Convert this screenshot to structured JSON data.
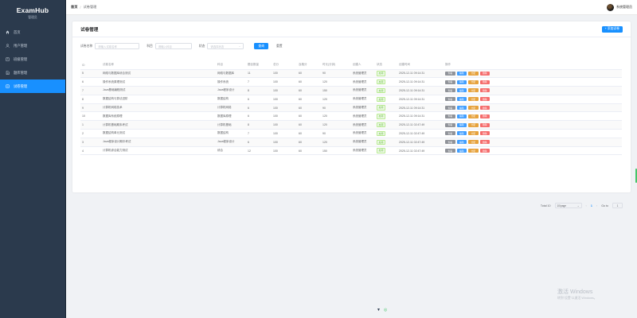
{
  "app": {
    "title": "ExamHub",
    "subtitle": "管理员"
  },
  "sidebar": {
    "items": [
      {
        "label": "首页",
        "icon": "home-icon",
        "active": false
      },
      {
        "label": "用户管理",
        "icon": "user-icon",
        "active": false
      },
      {
        "label": "班级管理",
        "icon": "building-icon",
        "active": false
      },
      {
        "label": "题库管理",
        "icon": "document-icon",
        "active": false
      },
      {
        "label": "试卷管理",
        "icon": "paper-icon",
        "active": true
      }
    ]
  },
  "breadcrumb": {
    "home": "首页",
    "separator": "/",
    "current": "试卷管理"
  },
  "user": {
    "name": "系统管理员"
  },
  "card": {
    "title": "试卷管理",
    "add_label": "+ 添加试卷"
  },
  "filters": {
    "name_label": "试卷名称",
    "name_placeholder": "请输入试卷名称",
    "subject_label": "科目",
    "subject_placeholder": "请输入科目",
    "status_label": "状态",
    "status_placeholder": "请选择状态",
    "query_label": "查询",
    "reset_label": "重置"
  },
  "table": {
    "headers": [
      "ID",
      "试卷名称",
      "科目",
      "题目数量",
      "总分",
      "及格分",
      "时长(分钟)",
      "创建人",
      "状态",
      "创建时间",
      "操作"
    ],
    "op_labels": {
      "view": "查看",
      "edit": "编辑",
      "assign": "分配",
      "delete": "删除"
    },
    "rows": [
      {
        "id": "5",
        "name": "网络与数据库综合测试",
        "subject": "网络与数据库",
        "count": "11",
        "total": "100",
        "pass": "60",
        "duration": "90",
        "creator": "系统管理员",
        "status": "启用",
        "created": "2025-12-11 09:14:31"
      },
      {
        "id": "6",
        "name": "操作系统原理测试",
        "subject": "操作系统",
        "count": "7",
        "total": "100",
        "pass": "60",
        "duration": "120",
        "creator": "系统管理员",
        "status": "启用",
        "created": "2025-12-11 09:14:31"
      },
      {
        "id": "7",
        "name": "Java基础编程测试",
        "subject": "Java程序设计",
        "count": "8",
        "total": "100",
        "pass": "60",
        "duration": "150",
        "creator": "系统管理员",
        "status": "启用",
        "created": "2025-12-11 09:14:31"
      },
      {
        "id": "8",
        "name": "数据结构与算法进阶",
        "subject": "数据结构",
        "count": "6",
        "total": "100",
        "pass": "60",
        "duration": "120",
        "creator": "系统管理员",
        "status": "启用",
        "created": "2025-12-11 09:14:31"
      },
      {
        "id": "9",
        "name": "计算机网络技术",
        "subject": "计算机网络",
        "count": "6",
        "total": "100",
        "pass": "60",
        "duration": "90",
        "creator": "系统管理员",
        "status": "启用",
        "created": "2025-12-11 09:14:31"
      },
      {
        "id": "10",
        "name": "数据库系统原理",
        "subject": "数据库原理",
        "count": "6",
        "total": "100",
        "pass": "60",
        "duration": "120",
        "creator": "系统管理员",
        "status": "启用",
        "created": "2025-12-11 09:14:31"
      },
      {
        "id": "1",
        "name": "计算机基础期末考试",
        "subject": "计算机基础",
        "count": "8",
        "total": "100",
        "pass": "60",
        "duration": "120",
        "creator": "系统管理员",
        "status": "启用",
        "created": "2025-12-11 02:47:49"
      },
      {
        "id": "2",
        "name": "数据结构单元测试",
        "subject": "数据结构",
        "count": "7",
        "total": "100",
        "pass": "60",
        "duration": "90",
        "creator": "系统管理员",
        "status": "启用",
        "created": "2025-12-11 02:47:49"
      },
      {
        "id": "3",
        "name": "Java程序设计期中考试",
        "subject": "Java程序设计",
        "count": "6",
        "total": "100",
        "pass": "60",
        "duration": "120",
        "creator": "系统管理员",
        "status": "启用",
        "created": "2025-12-11 02:47:49"
      },
      {
        "id": "4",
        "name": "计算机综合能力测试",
        "subject": "综合",
        "count": "12",
        "total": "100",
        "pass": "60",
        "duration": "150",
        "creator": "系统管理员",
        "status": "启用",
        "created": "2025-12-11 02:47:49"
      }
    ]
  },
  "pagination": {
    "total": "Total 10",
    "page_size": "10/page",
    "prev": "‹",
    "page": "1",
    "next": "›",
    "goto_label": "Go to",
    "goto_value": "1"
  },
  "watermark": {
    "line1": "激活 Windows",
    "line2": "转到\"设置\"以激活 Windows。"
  },
  "colors": {
    "sidebar_bg": "#2b3a4d",
    "accent": "#1890ff",
    "status_ok": "#67c23a",
    "view": "#909399",
    "edit": "#409eff",
    "assign": "#e6a23c",
    "delete": "#f56c6c"
  }
}
